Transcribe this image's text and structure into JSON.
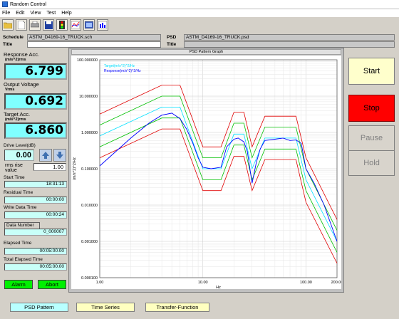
{
  "window": {
    "title": "Random Control"
  },
  "menu": [
    "File",
    "Edit",
    "View",
    "Test",
    "Help"
  ],
  "toolbar_icons": [
    "open-folder-icon",
    "new-document-icon",
    "print-icon",
    "save-icon",
    "traffic-light-icon",
    "graph-icon",
    "image-icon",
    "bar-chart-icon"
  ],
  "header": {
    "schedule_label": "Schedule",
    "schedule_value": "ASTM_D4169-16_TRUCK.sch",
    "title_label": "Title",
    "title_value": "",
    "psd_label": "PSD",
    "psd_value": "ASTM_D4169-16_TRUCK.psd",
    "psd_title_label": "Title",
    "psd_title_value": ""
  },
  "left": {
    "response_acc_label": "Response Acc.",
    "response_acc_unit": "(m/s^2)rms",
    "response_acc_value": "6.799",
    "output_voltage_label": "Output Voltage",
    "output_voltage_unit": "Vrms",
    "output_voltage_value": "0.692",
    "target_acc_label": "Target Acc.",
    "target_acc_unit": "(m/s^2)rms",
    "target_acc_value": "6.860",
    "drive_level_label": "Drive Level(dB)",
    "drive_level_value": "0.00",
    "rms_rise_label": "rms rise",
    "rms_rise_label2": "value",
    "rms_rise_value": "1.00",
    "start_time_label": "Start Time",
    "start_time_value": "18:31:13",
    "residual_time_label": "Residual Time",
    "residual_time_value": "00:00:00",
    "write_data_time_label": "Write Data Time",
    "write_data_time_value": "00:00:24",
    "data_number_label": "Data Number",
    "data_number_value": "0_000007",
    "elapsed_time_label": "Elapsed Time",
    "elapsed_time_value": "00:05:00.00",
    "total_elapsed_time_label": "Total Elapsed Time",
    "total_elapsed_time_value": "00:05:00.00",
    "alarm_label": "Alarm",
    "abort_label": "Abort"
  },
  "right_buttons": {
    "start": "Start",
    "stop": "Stop",
    "pause": "Pause",
    "hold": "Hold"
  },
  "colors": {
    "readout_bg": "#80ffff",
    "stop_red": "#ff0000",
    "start_bg": "#ffffcc",
    "alarm_green": "#00f000"
  },
  "tabs": [
    "PSD Pattern",
    "Time Series",
    "Transfer-Function"
  ],
  "chart_data": {
    "type": "line",
    "title": "PSD Pattern Graph",
    "xlabel": "Hz",
    "ylabel": "(m/s^2)^2/Hz",
    "xscale": "log",
    "yscale": "log",
    "xlim": [
      1,
      200
    ],
    "ylim": [
      0.0001,
      100
    ],
    "x_ticks": [
      "1.00",
      "10.00",
      "100.00",
      "200.00"
    ],
    "y_ticks": [
      "100.000000",
      "10.000000",
      "1.000000",
      "0.100000",
      "0.010000",
      "0.001000",
      "0.000100"
    ],
    "legend": [
      "Target(m/s^2)^2/Hz",
      "Response(m/s^2)^2/Hz"
    ],
    "series": [
      {
        "name": "Target(m/s^2)^2/Hz",
        "color": "#00e0ff",
        "x": [
          1,
          4,
          6,
          10,
          15,
          20,
          25,
          30,
          40,
          80,
          100,
          200
        ],
        "y": [
          0.8,
          5,
          5,
          0.1,
          0.1,
          0.9,
          0.9,
          0.1,
          0.7,
          0.7,
          0.05,
          0.001
        ]
      },
      {
        "name": "Response(m/s^2)^2/Hz",
        "color": "#0000ff",
        "x": [
          1,
          2,
          3,
          4,
          5,
          6,
          7,
          8,
          9,
          10,
          12,
          15,
          17,
          20,
          22,
          25,
          27,
          30,
          33,
          36,
          40,
          50,
          60,
          70,
          80,
          90,
          100,
          120,
          150,
          200
        ],
        "y": [
          0.12,
          0.7,
          1.8,
          3.0,
          3.4,
          2.4,
          1.2,
          0.5,
          0.2,
          0.11,
          0.1,
          0.11,
          0.4,
          0.65,
          0.7,
          0.55,
          0.3,
          0.04,
          0.15,
          0.35,
          0.6,
          0.65,
          0.7,
          0.6,
          0.62,
          0.5,
          0.1,
          0.04,
          0.01,
          0.001
        ]
      },
      {
        "color": "#00c000",
        "x": [
          1,
          4,
          6,
          10,
          15,
          20,
          25,
          30,
          40,
          80,
          100,
          200
        ],
        "y": [
          1.6,
          10,
          10,
          0.2,
          0.2,
          1.8,
          1.8,
          0.2,
          1.4,
          1.4,
          0.1,
          0.002
        ]
      },
      {
        "color": "#00c000",
        "x": [
          1,
          4,
          6,
          10,
          15,
          20,
          25,
          30,
          40,
          80,
          100,
          200
        ],
        "y": [
          0.4,
          2.5,
          2.5,
          0.05,
          0.05,
          0.45,
          0.45,
          0.05,
          0.35,
          0.35,
          0.025,
          0.0005
        ]
      },
      {
        "color": "#e00000",
        "x": [
          1,
          4,
          6,
          10,
          15,
          20,
          25,
          30,
          40,
          80,
          100,
          200
        ],
        "y": [
          3.2,
          20,
          20,
          0.4,
          0.4,
          3.6,
          3.6,
          0.4,
          2.8,
          2.8,
          0.2,
          0.004
        ]
      },
      {
        "color": "#e00000",
        "x": [
          1,
          4,
          6,
          10,
          15,
          20,
          25,
          30,
          40,
          80,
          100,
          200
        ],
        "y": [
          0.2,
          1.25,
          1.25,
          0.025,
          0.025,
          0.22,
          0.22,
          0.025,
          0.18,
          0.18,
          0.012,
          0.00025
        ]
      }
    ]
  }
}
